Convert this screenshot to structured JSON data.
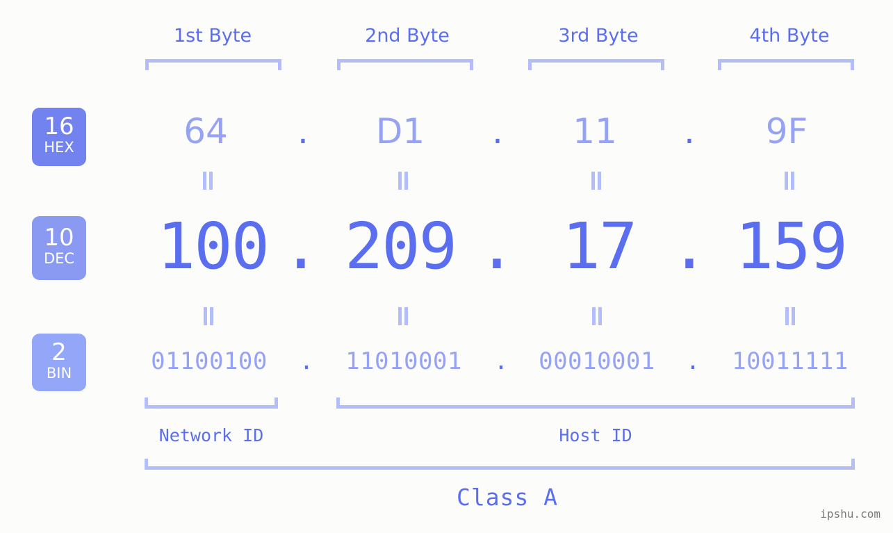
{
  "meta": {
    "background_color": "#fcfdfa",
    "accent_color": "#5b6ef0",
    "accent_light_color": "#96a3f5",
    "bracket_color": "#b3bdfa",
    "watermark": "ipshu.com"
  },
  "headers": {
    "byte_labels": [
      "1st Byte",
      "2nd Byte",
      "3rd Byte",
      "4th Byte"
    ]
  },
  "bases": [
    {
      "number": "16",
      "name": "HEX",
      "color": "#7282ee"
    },
    {
      "number": "10",
      "name": "DEC",
      "color": "#8a99f2"
    },
    {
      "number": "2",
      "name": "BIN",
      "color": "#94a6f7"
    }
  ],
  "rows": {
    "hex": {
      "base": "16",
      "values": [
        "64",
        "D1",
        "11",
        "9F"
      ],
      "separator": "."
    },
    "dec": {
      "base": "10",
      "values": [
        "100",
        "209",
        "17",
        "159"
      ],
      "separator": "."
    },
    "bin": {
      "base": "2",
      "values": [
        "01100100",
        "11010001",
        "00010001",
        "10011111"
      ],
      "separator": "."
    }
  },
  "equality_symbol": "=",
  "footer": {
    "network_id_label": "Network ID",
    "host_id_label": "Host ID",
    "class_label": "Class A"
  }
}
